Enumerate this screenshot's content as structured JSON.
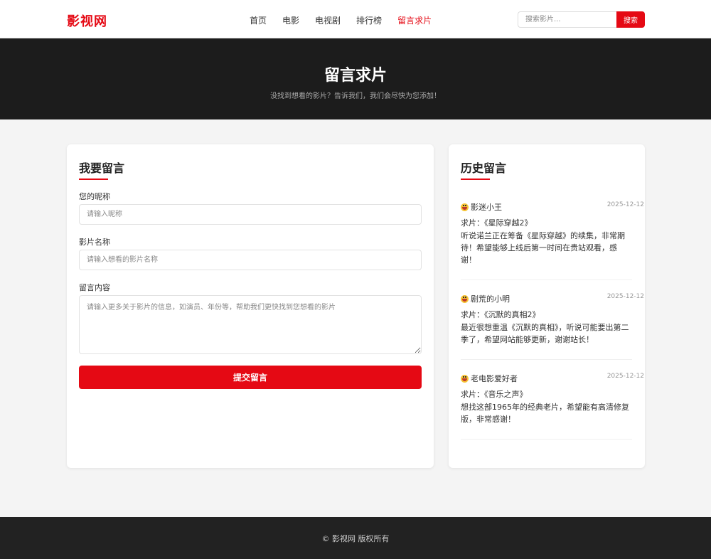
{
  "header": {
    "logo": "影视网",
    "nav": [
      {
        "label": "首页"
      },
      {
        "label": "电影"
      },
      {
        "label": "电视剧"
      },
      {
        "label": "排行榜"
      },
      {
        "label": "留言求片"
      }
    ],
    "search_placeholder": "搜索影片...",
    "search_button": "搜索"
  },
  "hero": {
    "title": "留言求片",
    "subtitle": "没找到想看的影片？告诉我们，我们会尽快为您添加！"
  },
  "form": {
    "title": "我要留言",
    "nickname_label": "您的昵称",
    "nickname_placeholder": "请输入昵称",
    "film_label": "影片名称",
    "film_placeholder": "请输入想看的影片名称",
    "content_label": "留言内容",
    "content_placeholder": "请输入更多关于影片的信息，如演员、年份等，帮助我们更快找到您想看的影片",
    "submit": "提交留言"
  },
  "history": {
    "title": "历史留言",
    "messages": [
      {
        "user": "影迷小王",
        "date": "2025-12-12",
        "film": "求片：《星际穿越2》",
        "body": "听说诺兰正在筹备《星际穿越》的续集，非常期待！希望能够上线后第一时间在贵站观看，感谢！"
      },
      {
        "user": "剧荒的小明",
        "date": "2025-12-12",
        "film": "求片：《沉默的真相2》",
        "body": "最近很想重温《沉默的真相》，听说可能要出第二季了，希望网站能够更新，谢谢站长！"
      },
      {
        "user": "老电影爱好者",
        "date": "2025-12-12",
        "film": "求片：《音乐之声》",
        "body": "想找这部1965年的经典老片，希望能有高清修复版，非常感谢！"
      }
    ]
  },
  "footer": {
    "copyright": "© 影视网 版权所有"
  },
  "colors": {
    "accent": "#e50914",
    "hero_bg": "#1c1c1c",
    "footer_bg": "#222222",
    "page_bg": "#f4f4f4"
  }
}
